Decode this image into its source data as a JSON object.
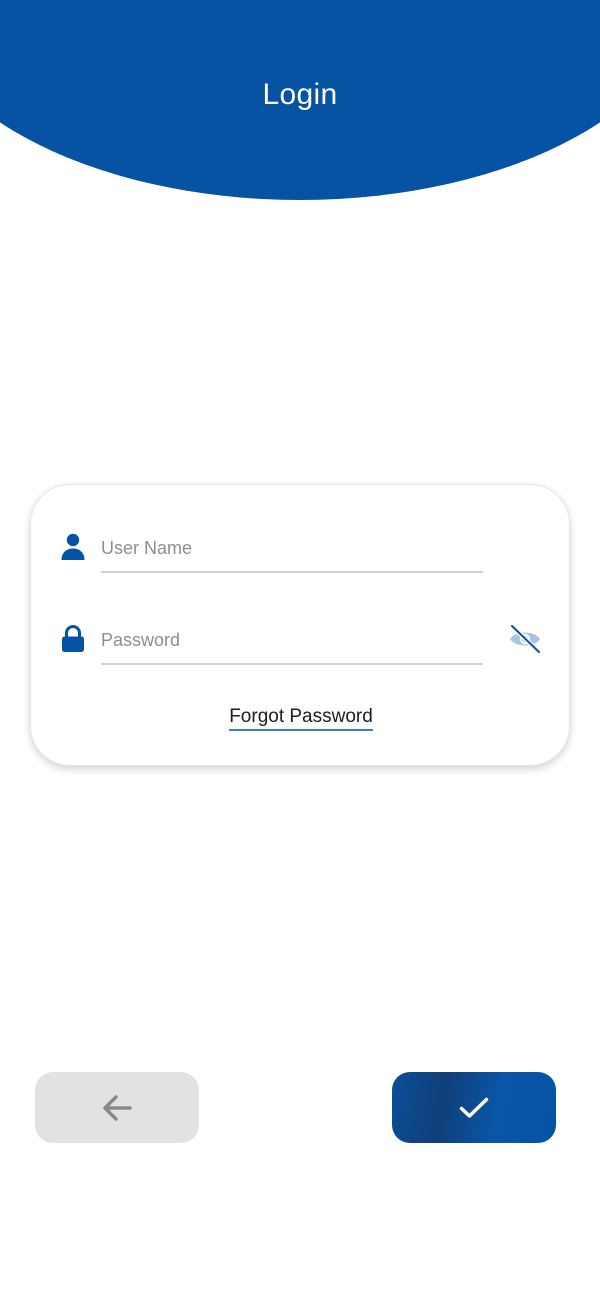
{
  "header": {
    "title": "Login"
  },
  "login_form": {
    "username": {
      "icon": "user-icon",
      "placeholder": "User Name",
      "value": ""
    },
    "password": {
      "icon": "lock-icon",
      "placeholder": "Password",
      "value": "",
      "visibility_icon": "eye-off-icon"
    },
    "forgot_password_label": "Forgot Password"
  },
  "actions": {
    "back_icon": "arrow-left-icon",
    "confirm_icon": "check-icon"
  },
  "colors": {
    "primary": "#0653a3",
    "secondary_button": "#e2e2e2",
    "input_underline": "#d2d2d2",
    "link_underline": "#3b7dcf"
  }
}
